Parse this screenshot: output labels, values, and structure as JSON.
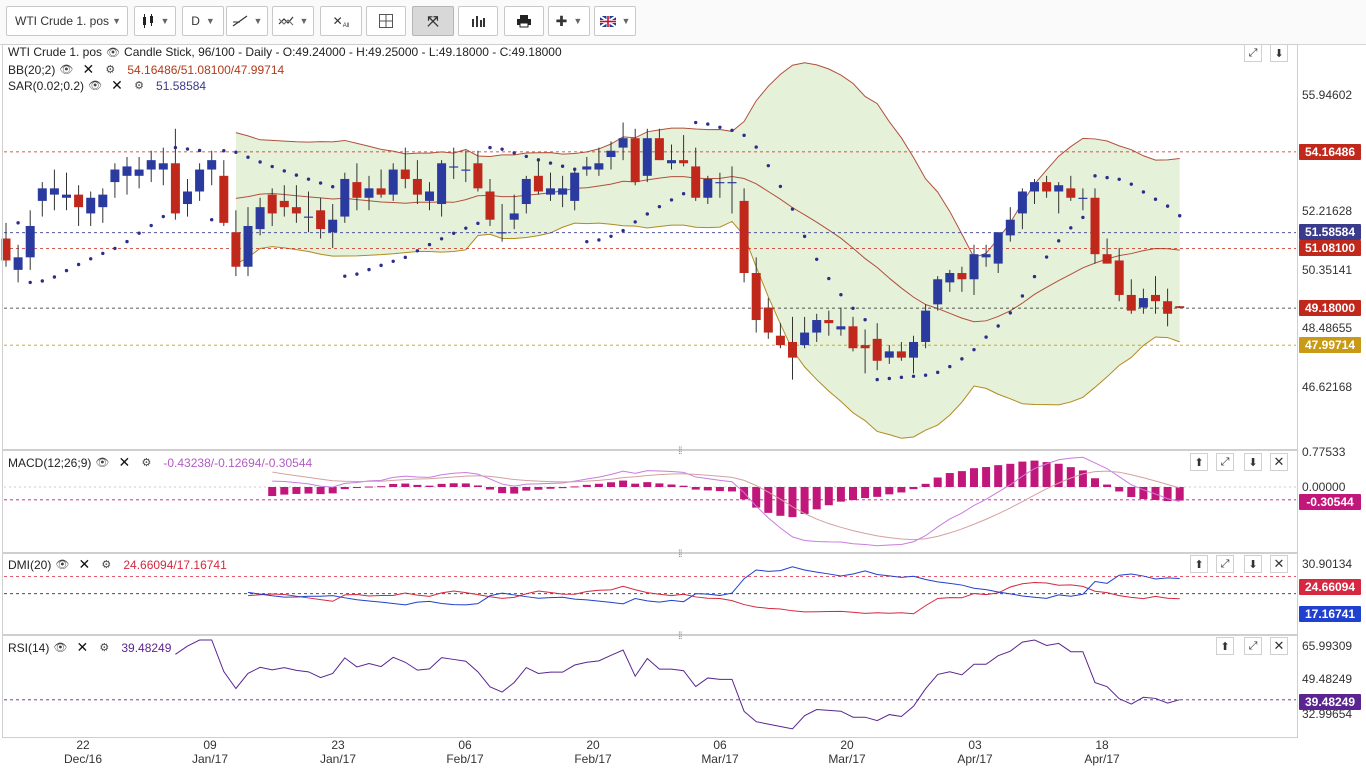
{
  "toolbar": {
    "instrument": "WTI Crude 1. pos",
    "timeframe": "D",
    "all_label": "All",
    "icons": [
      "candlestick-icon",
      "line-draw-icon",
      "compare-icon",
      "clear-all-icon",
      "crosshair-icon",
      "fit-icon",
      "bar-chart-icon",
      "print-icon",
      "indicator-icon",
      "flag-icon"
    ]
  },
  "main": {
    "title": "WTI Crude 1. pos",
    "info": "Candle Stick, 96/100 - Daily - O:49.24000 - H:49.25000 - L:49.18000 - C:49.18000",
    "bb_label": "BB(20;2)",
    "bb_values": "54.16486/51.08100/47.99714",
    "sar_label": "SAR(0.02;0.2)",
    "sar_value": "51.58584",
    "axis_ticks": [
      "55.94602",
      "52.21628",
      "50.35141",
      "48.48655",
      "46.62168"
    ],
    "tags": {
      "bb_upper": "54.16486",
      "sar": "51.58584",
      "bb_mid": "51.08100",
      "close": "49.18000",
      "bb_lower": "47.99714"
    }
  },
  "macd": {
    "label": "MACD(12;26;9)",
    "values": "-0.43238/-0.12694/-0.30544",
    "axis_ticks": [
      "0.77533",
      "0.00000"
    ],
    "tag": "-0.30544"
  },
  "dmi": {
    "label": "DMI(20)",
    "values": "24.66094/17.16741",
    "axis_tick": "30.90134",
    "tag_plus": "24.66094",
    "tag_minus": "17.16741"
  },
  "rsi": {
    "label": "RSI(14)",
    "value": "39.48249",
    "axis_ticks": [
      "65.99309",
      "49.48249",
      "32.99654"
    ],
    "tag": "39.48249"
  },
  "dates": [
    {
      "day": "22",
      "month": "Dec/16"
    },
    {
      "day": "09",
      "month": "Jan/17"
    },
    {
      "day": "23",
      "month": "Jan/17"
    },
    {
      "day": "06",
      "month": "Feb/17"
    },
    {
      "day": "20",
      "month": "Feb/17"
    },
    {
      "day": "06",
      "month": "Mar/17"
    },
    {
      "day": "20",
      "month": "Mar/17"
    },
    {
      "day": "03",
      "month": "Apr/17"
    },
    {
      "day": "18",
      "month": "Apr/17"
    }
  ],
  "colors": {
    "up": "#2b3a9e",
    "down": "#c0281c",
    "bb_band": "#e5f0d8",
    "bb_upper_line": "#b0503c",
    "bb_lower_line": "#b08a20",
    "sar_dot": "#2b2f8a",
    "macd_hist": "#c2177a",
    "macd_line": "#c77de0",
    "macd_signal": "#d4a0a0",
    "dmi_plus": "#d62840",
    "dmi_minus": "#2040d0",
    "rsi_line": "#5a2590"
  },
  "chart_data": {
    "type": "candlestick",
    "instrument": "WTI Crude 1. pos",
    "interval": "Daily",
    "last": {
      "open": 49.24,
      "high": 49.25,
      "low": 49.18,
      "close": 49.18
    },
    "ohlc": [
      [
        51.4,
        51.9,
        50.5,
        50.7
      ],
      [
        50.4,
        51.2,
        50.0,
        50.8
      ],
      [
        50.8,
        52.3,
        50.4,
        51.8
      ],
      [
        52.6,
        53.2,
        52.1,
        53.0
      ],
      [
        52.8,
        53.6,
        52.3,
        53.0
      ],
      [
        52.7,
        53.5,
        52.3,
        52.8
      ],
      [
        52.8,
        53.1,
        51.8,
        52.4
      ],
      [
        52.2,
        52.9,
        51.8,
        52.7
      ],
      [
        52.4,
        53.0,
        51.9,
        52.8
      ],
      [
        53.2,
        53.8,
        52.7,
        53.6
      ],
      [
        53.4,
        54.0,
        52.8,
        53.7
      ],
      [
        53.4,
        54.0,
        53.0,
        53.6
      ],
      [
        53.6,
        54.2,
        53.2,
        53.9
      ],
      [
        53.6,
        54.3,
        53.1,
        53.8
      ],
      [
        53.8,
        54.9,
        52.0,
        52.2
      ],
      [
        52.5,
        53.3,
        52.1,
        52.9
      ],
      [
        52.9,
        53.8,
        52.6,
        53.6
      ],
      [
        53.6,
        54.2,
        53.1,
        53.9
      ],
      [
        53.4,
        53.9,
        51.8,
        51.9
      ],
      [
        51.6,
        52.3,
        50.2,
        50.5
      ],
      [
        50.5,
        52.4,
        50.2,
        51.8
      ],
      [
        51.7,
        52.7,
        51.5,
        52.4
      ],
      [
        52.8,
        53.0,
        51.8,
        52.2
      ],
      [
        52.6,
        53.1,
        52.1,
        52.4
      ],
      [
        52.4,
        53.1,
        51.9,
        52.2
      ],
      [
        52.1,
        52.9,
        51.6,
        52.1
      ],
      [
        52.3,
        52.7,
        51.4,
        51.7
      ],
      [
        51.6,
        52.5,
        51.1,
        52.0
      ],
      [
        52.1,
        53.5,
        51.9,
        53.3
      ],
      [
        53.2,
        53.8,
        52.3,
        52.7
      ],
      [
        52.7,
        53.4,
        52.3,
        53.0
      ],
      [
        53.0,
        53.6,
        52.7,
        52.8
      ],
      [
        52.8,
        53.8,
        52.6,
        53.6
      ],
      [
        53.6,
        54.3,
        53.0,
        53.3
      ],
      [
        53.3,
        53.9,
        52.5,
        52.8
      ],
      [
        52.6,
        53.2,
        52.3,
        52.9
      ],
      [
        52.5,
        53.9,
        52.1,
        53.8
      ],
      [
        53.7,
        54.3,
        53.3,
        53.7
      ],
      [
        53.6,
        54.2,
        53.2,
        53.6
      ],
      [
        53.8,
        54.2,
        52.9,
        53.0
      ],
      [
        52.9,
        53.3,
        51.8,
        52.0
      ],
      [
        51.6,
        52.5,
        51.3,
        51.6
      ],
      [
        52.0,
        52.8,
        51.7,
        52.2
      ],
      [
        52.5,
        53.4,
        52.2,
        53.3
      ],
      [
        53.4,
        53.9,
        52.8,
        52.9
      ],
      [
        52.8,
        53.5,
        52.6,
        53.0
      ],
      [
        52.8,
        53.4,
        52.4,
        53.0
      ],
      [
        52.6,
        53.6,
        52.3,
        53.5
      ],
      [
        53.6,
        54.0,
        53.4,
        53.7
      ],
      [
        53.6,
        54.3,
        53.4,
        53.8
      ],
      [
        54.0,
        54.5,
        53.6,
        54.2
      ],
      [
        54.3,
        55.1,
        53.9,
        54.6
      ],
      [
        54.6,
        54.9,
        53.1,
        53.2
      ],
      [
        53.4,
        54.9,
        53.2,
        54.6
      ],
      [
        54.6,
        54.9,
        53.9,
        53.9
      ],
      [
        53.8,
        54.4,
        53.6,
        53.9
      ],
      [
        53.9,
        54.7,
        53.7,
        53.8
      ],
      [
        53.7,
        54.3,
        52.6,
        52.7
      ],
      [
        52.7,
        53.4,
        52.5,
        53.3
      ],
      [
        53.2,
        53.5,
        52.7,
        53.2
      ],
      [
        53.2,
        53.7,
        52.2,
        53.2
      ],
      [
        52.6,
        53.0,
        50.0,
        50.3
      ],
      [
        50.3,
        50.8,
        48.4,
        48.8
      ],
      [
        49.2,
        49.5,
        48.2,
        48.4
      ],
      [
        48.3,
        48.7,
        47.9,
        48.0
      ],
      [
        48.1,
        48.9,
        46.9,
        47.6
      ],
      [
        48.0,
        48.9,
        47.9,
        48.4
      ],
      [
        48.4,
        49.0,
        48.1,
        48.8
      ],
      [
        48.8,
        49.1,
        48.3,
        48.7
      ],
      [
        48.5,
        49.2,
        48.3,
        48.6
      ],
      [
        48.6,
        48.9,
        47.8,
        47.9
      ],
      [
        48.0,
        48.5,
        47.1,
        47.9
      ],
      [
        48.2,
        48.7,
        47.2,
        47.5
      ],
      [
        47.6,
        48.0,
        47.4,
        47.8
      ],
      [
        47.8,
        48.1,
        47.5,
        47.6
      ],
      [
        47.6,
        48.3,
        47.1,
        48.1
      ],
      [
        48.1,
        49.3,
        47.9,
        49.1
      ],
      [
        49.3,
        50.2,
        49.1,
        50.1
      ],
      [
        50.0,
        50.4,
        49.7,
        50.3
      ],
      [
        50.3,
        50.5,
        49.7,
        50.1
      ],
      [
        50.1,
        51.2,
        49.6,
        50.9
      ],
      [
        50.8,
        51.2,
        50.5,
        50.9
      ],
      [
        50.6,
        51.6,
        50.3,
        51.6
      ],
      [
        51.5,
        52.4,
        51.3,
        52.0
      ],
      [
        52.2,
        53.0,
        51.7,
        52.9
      ],
      [
        52.9,
        53.3,
        52.5,
        53.2
      ],
      [
        53.2,
        53.4,
        52.7,
        52.9
      ],
      [
        52.9,
        53.2,
        52.2,
        53.1
      ],
      [
        53.0,
        53.4,
        52.6,
        52.7
      ],
      [
        52.7,
        53.0,
        52.3,
        52.7
      ],
      [
        52.7,
        53.0,
        50.6,
        50.9
      ],
      [
        50.9,
        51.4,
        50.6,
        50.6
      ],
      [
        50.7,
        51.1,
        49.4,
        49.6
      ],
      [
        49.6,
        50.1,
        49.0,
        49.1
      ],
      [
        49.2,
        49.8,
        49.0,
        49.5
      ],
      [
        49.6,
        50.2,
        49.0,
        49.4
      ],
      [
        49.4,
        49.8,
        48.6,
        49.0
      ],
      [
        49.24,
        49.25,
        49.18,
        49.18
      ]
    ]
  }
}
